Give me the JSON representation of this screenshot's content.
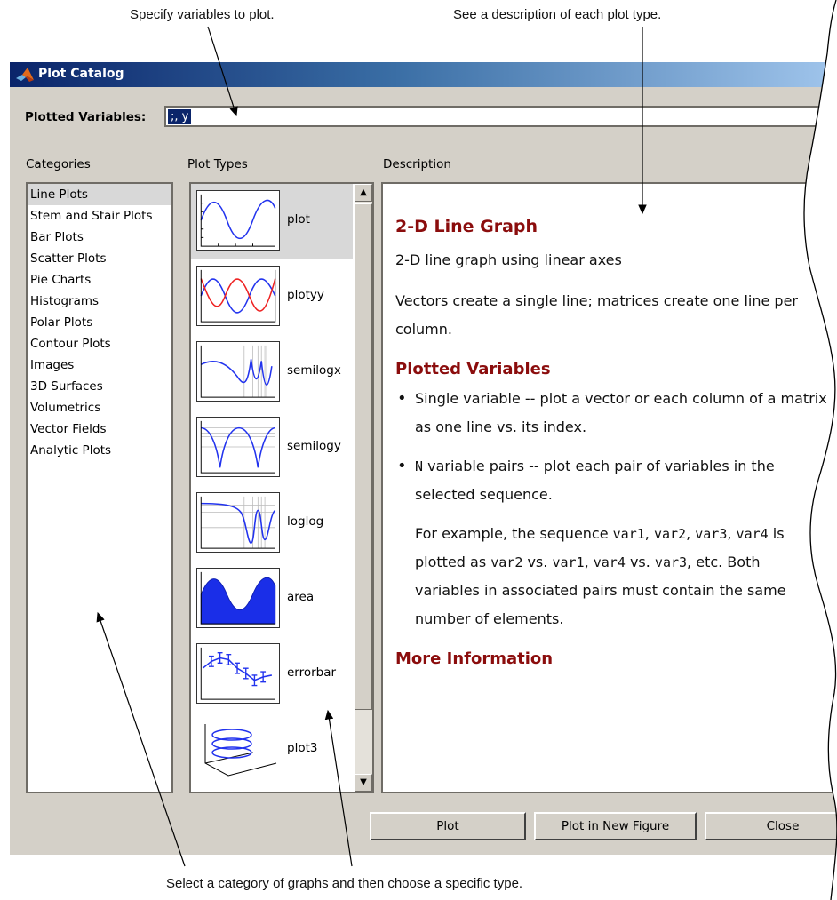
{
  "callouts": {
    "top_left": "Specify variables to plot.",
    "top_right": "See a description of each plot type.",
    "bottom": "Select a category of graphs and then choose a specific type."
  },
  "window": {
    "title": "Plot Catalog",
    "title_gradient": [
      "#0a246a",
      "#a6caf0"
    ]
  },
  "plotted_variables": {
    "label": "Plotted Variables:",
    "value": ";, y"
  },
  "columns": {
    "categories": "Categories",
    "plot_types": "Plot Types",
    "description": "Description"
  },
  "categories": [
    "Line Plots",
    "Stem and Stair Plots",
    "Bar Plots",
    "Scatter Plots",
    "Pie Charts",
    "Histograms",
    "Polar Plots",
    "Contour Plots",
    "Images",
    "3D Surfaces",
    "Volumetrics",
    "Vector Fields",
    "Analytic Plots"
  ],
  "selected_category": "Line Plots",
  "plot_types": [
    {
      "name": "plot",
      "icon": "plot-icon"
    },
    {
      "name": "plotyy",
      "icon": "plotyy-icon"
    },
    {
      "name": "semilogx",
      "icon": "semilogx-icon"
    },
    {
      "name": "semilogy",
      "icon": "semilogy-icon"
    },
    {
      "name": "loglog",
      "icon": "loglog-icon"
    },
    {
      "name": "area",
      "icon": "area-icon"
    },
    {
      "name": "errorbar",
      "icon": "errorbar-icon"
    },
    {
      "name": "plot3",
      "icon": "plot3-icon"
    }
  ],
  "selected_plot_type": "plot",
  "description": {
    "heading": "2-D Line Graph",
    "summary": "2-D line graph using linear axes",
    "detail": "Vectors create a single line; matrices create one line per column.",
    "variables_heading": "Plotted Variables",
    "bullet1": "Single variable -- plot a vector or each column of a matrix as one line vs. its index.",
    "bullet2_n": "N",
    "bullet2": " variable pairs -- plot each pair of variables in the selected sequence.",
    "example_parts": [
      {
        "text": "For example, the sequence ",
        "mono": false
      },
      {
        "text": "var1",
        "mono": true
      },
      {
        "text": ", ",
        "mono": false
      },
      {
        "text": "var2",
        "mono": true
      },
      {
        "text": ", ",
        "mono": false
      },
      {
        "text": "var3",
        "mono": true
      },
      {
        "text": ", ",
        "mono": false
      },
      {
        "text": "var4",
        "mono": true
      },
      {
        "text": " is plotted as ",
        "mono": false
      },
      {
        "text": "var2",
        "mono": true
      },
      {
        "text": " vs. ",
        "mono": false
      },
      {
        "text": "var1",
        "mono": true
      },
      {
        "text": ", ",
        "mono": false
      },
      {
        "text": "var4",
        "mono": true
      },
      {
        "text": " vs. ",
        "mono": false
      },
      {
        "text": "var3",
        "mono": true
      },
      {
        "text": ", etc. Both variables in associated pairs must contain the same number of elements.",
        "mono": false
      }
    ],
    "more_heading": "More Information",
    "heading_color": "#8b0d0d"
  },
  "buttons": {
    "plot": "Plot",
    "plot_new": "Plot in New Figure",
    "close": "Close"
  },
  "scroll": {
    "up_icon": "scroll-up-arrow-icon",
    "down_icon": "scroll-down-arrow-icon"
  }
}
